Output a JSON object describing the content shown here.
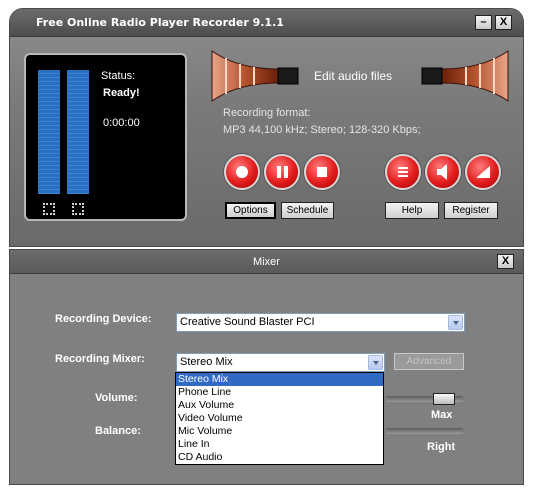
{
  "main_window": {
    "title": "Free Online Radio Player Recorder 9.1.1",
    "minimize_label": "–",
    "close_label": "X",
    "status_label": "Status:",
    "status_value": "Ready!",
    "timer": "0:00:00",
    "edit_audio_label": "Edit audio files",
    "recording_format_label": "Recording format:",
    "recording_format_value": "MP3 44,100 kHz; Stereo;  128-320 Kbps;",
    "buttons": {
      "options": "Options",
      "schedule": "Schedule",
      "help": "Help",
      "register": "Register"
    }
  },
  "mixer_window": {
    "title": "Mixer",
    "close_label": "X",
    "recording_device_label": "Recording Device:",
    "recording_device_value": "Creative Sound Blaster PCI",
    "recording_mixer_label": "Recording Mixer:",
    "recording_mixer_value": "Stereo Mix",
    "advanced_label": "Advanced",
    "volume_label": "Volume:",
    "volume_max_label": "Max",
    "balance_label": "Balance:",
    "balance_right_label": "Right",
    "dropdown_options": [
      "Stereo Mix",
      "Phone Line",
      "Aux Volume",
      "Video Volume",
      "Mic Volume",
      "Line In",
      "CD Audio"
    ],
    "dropdown_selected": "Stereo Mix"
  },
  "colors": {
    "record_buttons": "#e21c1c",
    "vu_meter": "#3b84d6",
    "selection_highlight": "#316ac5"
  }
}
